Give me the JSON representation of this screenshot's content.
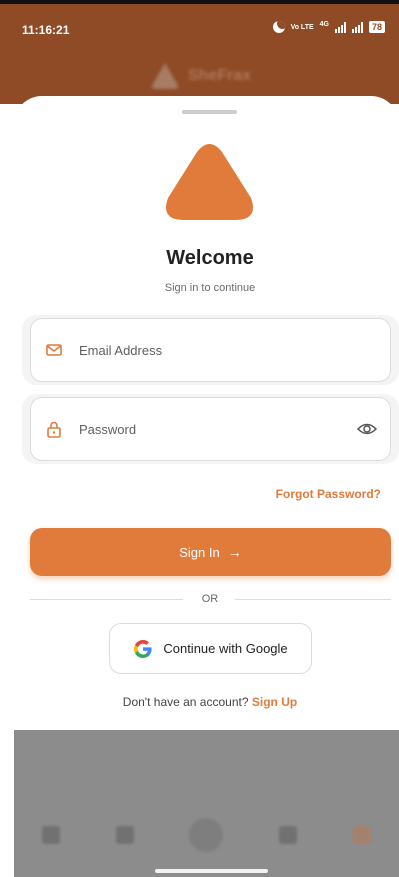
{
  "status_bar": {
    "time": "11:16:21",
    "volte": "Vo LTE",
    "network": "4G",
    "battery": "78"
  },
  "background_brand": "SheFrax",
  "auth": {
    "title": "Welcome",
    "subtitle": "Sign in to continue",
    "email": {
      "placeholder": "Email Address",
      "value": ""
    },
    "password": {
      "placeholder": "Password",
      "value": ""
    },
    "forgot_label": "Forgot Password?",
    "signin_label": "Sign In",
    "divider_label": "OR",
    "google_label": "Continue with Google",
    "signup_prompt": "Don't have an account?",
    "signup_link": "Sign Up"
  },
  "colors": {
    "accent": "#e07b3c",
    "status_bar": "#8f4a26"
  },
  "icons": {
    "email": "mail-icon",
    "password": "lock-icon",
    "visibility": "eye-icon",
    "arrow": "arrow-right-icon",
    "google": "google-logo-icon"
  }
}
